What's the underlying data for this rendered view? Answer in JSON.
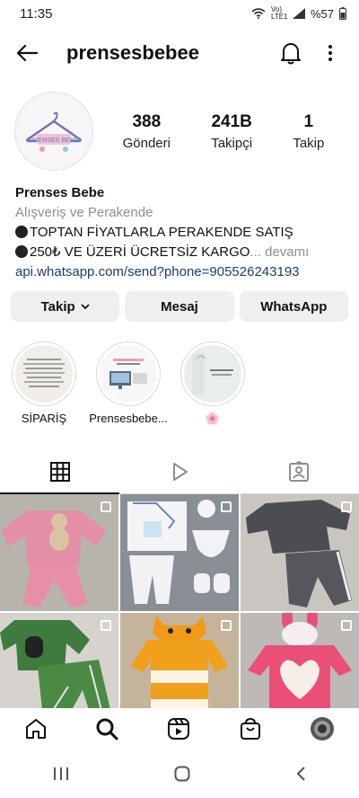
{
  "status_bar": {
    "time": "11:35",
    "network": "Vo) LTE1",
    "battery": "%57"
  },
  "app_bar": {
    "username": "prensesbebee"
  },
  "profile": {
    "avatar_text": "PRENSES BEBE",
    "stats": [
      {
        "value": "388",
        "label": "Gönderi"
      },
      {
        "value": "241B",
        "label": "Takipçi"
      },
      {
        "value": "1",
        "label": "Takip"
      }
    ]
  },
  "bio": {
    "name": "Prenses Bebe",
    "category": "Alışveriş ve Perakende",
    "line1": "TOPTAN FİYATLARLA PERAKENDE SATIŞ",
    "line2": "250₺ VE ÜZERİ ÜCRETSİZ KARGO",
    "more": "... devamı",
    "link": "api.whatsapp.com/send?phone=905526243193"
  },
  "buttons": {
    "follow": "Takip",
    "message": "Mesaj",
    "whatsapp": "WhatsApp"
  },
  "highlights": [
    {
      "label": "SİPARİŞ"
    },
    {
      "label": "Prensesbebe..."
    },
    {
      "label": "🌸"
    }
  ],
  "colors": {
    "link": "#1d3d6b",
    "secondary_text": "#8e8e8e",
    "button_bg": "#efefef"
  }
}
